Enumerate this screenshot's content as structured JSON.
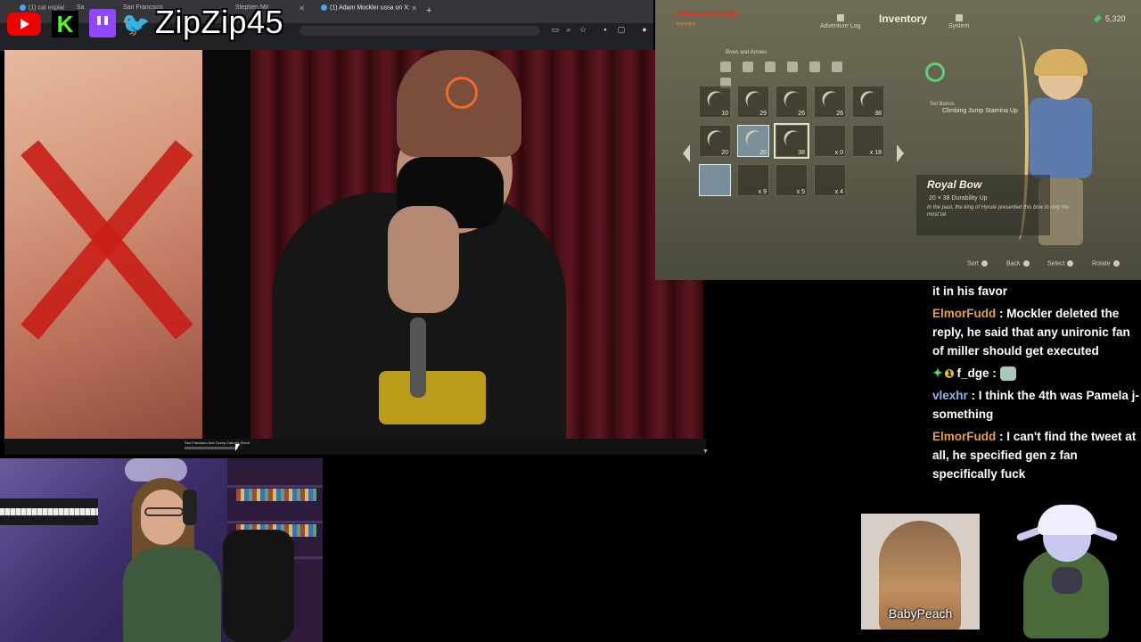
{
  "overlay": {
    "handle": "ZipZip45",
    "socials": [
      "youtube-icon",
      "kick-icon",
      "twitch-icon",
      "twitter-icon"
    ]
  },
  "browser": {
    "tabs": [
      {
        "label": "(1) cat explai",
        "icon": "twitter-icon"
      },
      {
        "label": "Sa",
        "icon": "twitter-icon"
      },
      {
        "label": "San Francisco",
        "icon": "youtube-icon"
      },
      {
        "label": "Stephen Mil",
        "icon": "twitter-icon"
      },
      {
        "label": "(1) Adam Mockler ussa on X:",
        "icon": "twitter-icon"
      }
    ],
    "new_tab": "+"
  },
  "video": {
    "title": "San Francisco Anti-Trump Catholic Event"
  },
  "game": {
    "hearts_row1": "♥♥♥♥♥♥♥♥♥♥♥♥♥♥♥♥",
    "hearts_row2": "♥♥♥♥♥",
    "nav": [
      "Adventure Log",
      "Inventory",
      "System"
    ],
    "rupees": "5,320",
    "category": "Bows and Arrows",
    "slots": [
      {
        "count": "10"
      },
      {
        "count": "29"
      },
      {
        "count": "26"
      },
      {
        "count": "26"
      },
      {
        "count": "38"
      },
      {
        "count": "20"
      },
      {
        "count": "20"
      },
      {
        "count": "38"
      },
      {
        "count": "x 0"
      },
      {
        "count": "x 18"
      },
      {
        "count": ""
      },
      {
        "count": "x 9"
      },
      {
        "count": "x 5"
      },
      {
        "count": "x 4"
      }
    ],
    "set_bonus_label": "Set Bonus",
    "set_bonus": "Climbing Jump Stamina Up",
    "item": {
      "name": "Royal Bow",
      "stats": "20  ×  38   Durability Up",
      "description": "In the past, the king of Hyrule presented this bow to only the most tal"
    },
    "hints": [
      "Sort",
      "Back",
      "Select",
      "Rotate"
    ]
  },
  "chat": {
    "messages": [
      {
        "user": "",
        "user_color": "#ffffff",
        "text": "it in his favor",
        "cut": true
      },
      {
        "user": "ElmorFudd",
        "user_color": "#e8a13a",
        "text": "Mockler deleted the reply, he said that any unironic fan of miller should get executed"
      },
      {
        "user": "f_dge",
        "user_color": "#ffffff",
        "text": "",
        "badges": true,
        "emote": true
      },
      {
        "user": "vlexhr",
        "user_color": "#8fb4e8",
        "text": "I think the 4th was Pamela j-something"
      },
      {
        "user": "ElmorFudd",
        "user_color": "#e8a13a",
        "text": "I can't find the tweet at all, he specified gen z fan specifically fuck"
      }
    ]
  },
  "avatars": {
    "babypeach_label": "BabyPeach"
  }
}
